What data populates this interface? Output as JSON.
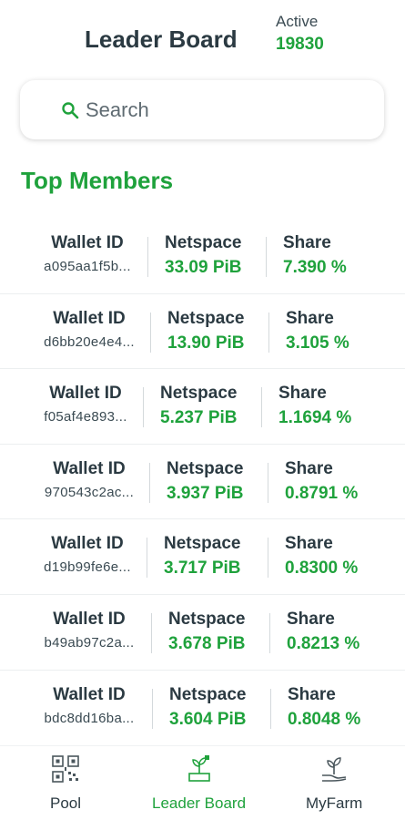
{
  "header": {
    "title": "Leader Board",
    "active_label": "Active",
    "active_count": "19830"
  },
  "search": {
    "placeholder": "Search",
    "icon": "search-icon"
  },
  "section": {
    "title": "Top Members"
  },
  "columns": {
    "wallet": "Wallet ID",
    "netspace": "Netspace",
    "share": "Share"
  },
  "members": [
    {
      "wallet": "a095aa1f5b...",
      "netspace": "33.09 PiB",
      "share": "7.390 %"
    },
    {
      "wallet": "d6bb20e4e4...",
      "netspace": "13.90 PiB",
      "share": "3.105 %"
    },
    {
      "wallet": "f05af4e893...",
      "netspace": "5.237 PiB",
      "share": "1.1694 %"
    },
    {
      "wallet": "970543c2ac...",
      "netspace": "3.937 PiB",
      "share": "0.8791 %"
    },
    {
      "wallet": "d19b99fe6e...",
      "netspace": "3.717 PiB",
      "share": "0.8300 %"
    },
    {
      "wallet": "b49ab97c2a...",
      "netspace": "3.678 PiB",
      "share": "0.8213 %"
    },
    {
      "wallet": "bdc8dd16ba...",
      "netspace": "3.604 PiB",
      "share": "0.8048 %"
    }
  ],
  "nav": {
    "items": [
      {
        "label": "Pool",
        "icon": "qr-code-icon",
        "active": false
      },
      {
        "label": "Leader Board",
        "icon": "leaderboard-plant-icon",
        "active": true
      },
      {
        "label": "MyFarm",
        "icon": "hand-sprout-icon",
        "active": false
      }
    ]
  },
  "colors": {
    "accent": "#1fa23c",
    "text": "#2b3a42"
  }
}
